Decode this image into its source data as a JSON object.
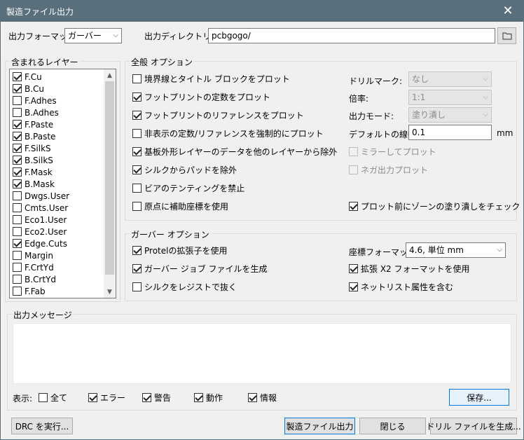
{
  "window": {
    "title": "製造ファイル出力",
    "close": "✕"
  },
  "format": {
    "label": "出力フォーマット:",
    "value": "ガーバー"
  },
  "directory": {
    "label": "出力ディレクトリー:",
    "value": "pcbgogo/"
  },
  "layers": {
    "title": "含まれるレイヤー",
    "items": [
      {
        "name": "F.Cu",
        "checked": true
      },
      {
        "name": "B.Cu",
        "checked": true
      },
      {
        "name": "F.Adhes",
        "checked": false
      },
      {
        "name": "B.Adhes",
        "checked": false
      },
      {
        "name": "F.Paste",
        "checked": true
      },
      {
        "name": "B.Paste",
        "checked": true
      },
      {
        "name": "F.SilkS",
        "checked": true
      },
      {
        "name": "B.SilkS",
        "checked": true
      },
      {
        "name": "F.Mask",
        "checked": true
      },
      {
        "name": "B.Mask",
        "checked": true
      },
      {
        "name": "Dwgs.User",
        "checked": false
      },
      {
        "name": "Cmts.User",
        "checked": false
      },
      {
        "name": "Eco1.User",
        "checked": false
      },
      {
        "name": "Eco2.User",
        "checked": false
      },
      {
        "name": "Edge.Cuts",
        "checked": true
      },
      {
        "name": "Margin",
        "checked": false
      },
      {
        "name": "F.CrtYd",
        "checked": false
      },
      {
        "name": "B.CrtYd",
        "checked": false
      },
      {
        "name": "F.Fab",
        "checked": false
      }
    ]
  },
  "general": {
    "title": "全般 オプション",
    "options": [
      {
        "label": "境界線とタイトル ブロックをプロット",
        "checked": false
      },
      {
        "label": "フットプリントの定数をプロット",
        "checked": true
      },
      {
        "label": "フットプリントのリファレンスをプロット",
        "checked": true
      },
      {
        "label": "非表示の定数/リファレンスを強制的にプロット",
        "checked": false
      },
      {
        "label": "基板外形レイヤーのデータを他のレイヤーから除外",
        "checked": true
      },
      {
        "label": "シルクからパッドを除外",
        "checked": true
      },
      {
        "label": "ビアのテンティングを禁止",
        "checked": false
      },
      {
        "label": "原点に補助座標を使用",
        "checked": false
      }
    ],
    "drill_mark": {
      "label": "ドリルマーク:",
      "value": "なし"
    },
    "scale": {
      "label": "倍率:",
      "value": "1:1"
    },
    "plot_mode": {
      "label": "出力モード:",
      "value": "塗り潰し"
    },
    "line_width": {
      "label": "デフォルトの線幅:",
      "value": "0.1",
      "unit": "mm"
    },
    "mirror": {
      "label": "ミラーしてプロット",
      "checked": false
    },
    "negative": {
      "label": "ネガ出力プロット",
      "checked": false
    },
    "zone_check": {
      "label": "プロット前にゾーンの塗り潰しをチェック",
      "checked": true
    }
  },
  "gerber": {
    "title": "ガーバー オプション",
    "options": [
      {
        "label": "Protelの拡張子を使用",
        "checked": true
      },
      {
        "label": "ガーバー ジョブ ファイルを生成",
        "checked": true
      },
      {
        "label": "シルクをレジストで抜く",
        "checked": false
      }
    ],
    "coord_format": {
      "label": "座標フォーマット:",
      "value": "4.6, 単位 mm"
    },
    "x2": {
      "label": "拡張 X2 フォーマットを使用",
      "checked": true
    },
    "netlist": {
      "label": "ネットリスト属性を含む",
      "checked": true
    }
  },
  "messages": {
    "title": "出力メッセージ",
    "show_label": "表示:",
    "filters": [
      {
        "label": "全て",
        "checked": false
      },
      {
        "label": "エラー",
        "checked": true
      },
      {
        "label": "警告",
        "checked": true
      },
      {
        "label": "動作",
        "checked": true
      },
      {
        "label": "情報",
        "checked": true
      }
    ],
    "save": "保存..."
  },
  "buttons": {
    "drc": "DRC を実行...",
    "plot": "製造ファイル出力",
    "close": "閉じる",
    "drill": "ドリル ファイルを生成..."
  }
}
